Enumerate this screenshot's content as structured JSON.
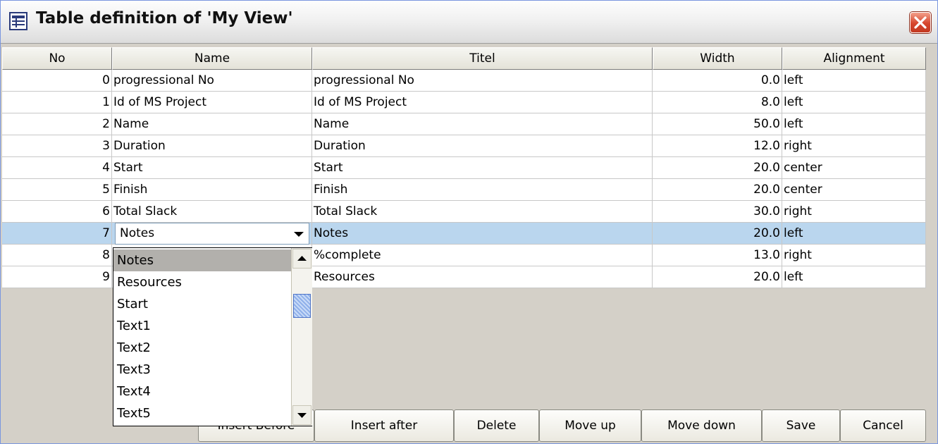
{
  "window": {
    "title": "Table definition of 'My View'",
    "icon": "table-icon",
    "close_icon": "close-icon"
  },
  "columns": [
    "No",
    "Name",
    "Titel",
    "Width",
    "Alignment"
  ],
  "rows": [
    {
      "no": "0",
      "name": "progressional No",
      "titel": "progressional No",
      "width": "0.0",
      "alignment": "left"
    },
    {
      "no": "1",
      "name": "Id of MS Project",
      "titel": "Id of MS Project",
      "width": "8.0",
      "alignment": "left"
    },
    {
      "no": "2",
      "name": "Name",
      "titel": "Name",
      "width": "50.0",
      "alignment": "left"
    },
    {
      "no": "3",
      "name": "Duration",
      "titel": "Duration",
      "width": "12.0",
      "alignment": "right"
    },
    {
      "no": "4",
      "name": "Start",
      "titel": "Start",
      "width": "20.0",
      "alignment": "center"
    },
    {
      "no": "5",
      "name": "Finish",
      "titel": "Finish",
      "width": "20.0",
      "alignment": "center"
    },
    {
      "no": "6",
      "name": "Total Slack",
      "titel": "Total Slack",
      "width": "30.0",
      "alignment": "right"
    },
    {
      "no": "7",
      "name": "Notes",
      "titel": "Notes",
      "width": "20.0",
      "alignment": "left"
    },
    {
      "no": "8",
      "name": "",
      "titel": "%complete",
      "width": "13.0",
      "alignment": "right"
    },
    {
      "no": "9",
      "name": "",
      "titel": "Resources",
      "width": "20.0",
      "alignment": "left"
    }
  ],
  "combo": {
    "selected": "Notes"
  },
  "dropdown": {
    "items": [
      "Notes",
      "Resources",
      "Start",
      "Text1",
      "Text2",
      "Text3",
      "Text4",
      "Text5"
    ],
    "highlighted": "Notes"
  },
  "buttons": {
    "insert_before": "Insert Before",
    "insert_after": "Insert after",
    "delete": "Delete",
    "move_up": "Move up",
    "move_down": "Move down",
    "save": "Save",
    "cancel": "Cancel"
  },
  "colors": {
    "selected_row": "#bad6ee",
    "dropdown_highlight": "#b2b0ac",
    "close_button": "#d6452c"
  }
}
